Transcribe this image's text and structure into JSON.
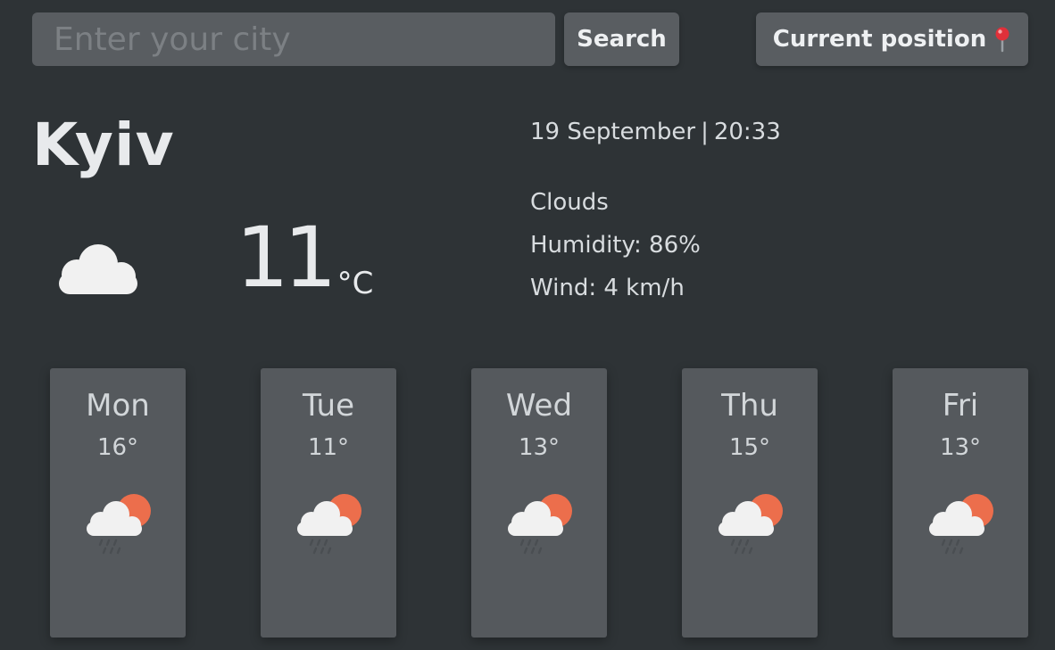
{
  "search": {
    "placeholder": "Enter your city",
    "button_label": "Search",
    "position_label": "Current position",
    "position_icon": "pin-icon"
  },
  "current": {
    "city": "Kyiv",
    "date": "19 September",
    "separator": "|",
    "time": "20:33",
    "description": "Clouds",
    "humidity_label": "Humidity: 86%",
    "wind_label": "Wind: 4 km/h",
    "temperature": "11",
    "unit": "°C",
    "icon": "cloud-icon"
  },
  "forecast": [
    {
      "day": "Mon",
      "temp": "16°",
      "icon": "partly-sunny-rain-icon"
    },
    {
      "day": "Tue",
      "temp": "11°",
      "icon": "partly-sunny-rain-icon"
    },
    {
      "day": "Wed",
      "temp": "13°",
      "icon": "partly-sunny-rain-icon"
    },
    {
      "day": "Thu",
      "temp": "15°",
      "icon": "partly-sunny-rain-icon"
    },
    {
      "day": "Fri",
      "temp": "13°",
      "icon": "partly-sunny-rain-icon"
    }
  ],
  "colors": {
    "background": "#2e3336",
    "panel": "#55595d",
    "sun": "#ec6e4c",
    "cloud": "#f1f1f1"
  }
}
